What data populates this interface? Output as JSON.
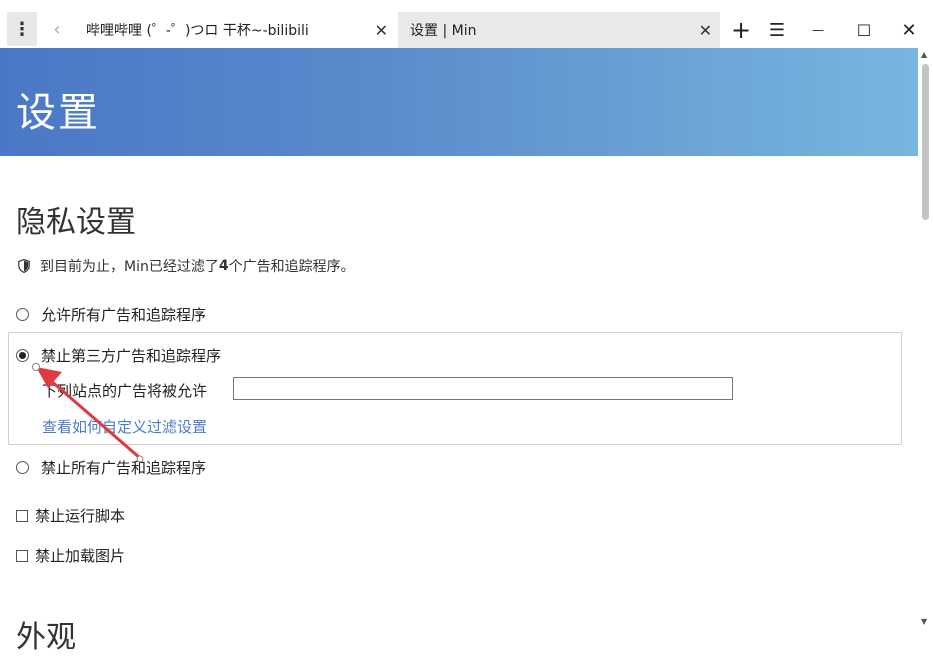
{
  "tabs": {
    "tab1_title": "哔哩哔哩 (゜-゜)つロ 干杯~-bilibili",
    "tab2_title": "设置 | Min"
  },
  "icons": {
    "menu": "⋮",
    "back": "‹",
    "close": "✕",
    "add": "+",
    "list": "☰",
    "minimize": "—",
    "maximize": "☐",
    "window_close": "✕"
  },
  "header": {
    "title": "设置"
  },
  "privacy": {
    "section_title": "隐私设置",
    "info_prefix": "到目前为止，Min已经过滤了",
    "info_count": "4",
    "info_suffix": "个广告和追踪程序。",
    "option_allow_all": "允许所有广告和追踪程序",
    "option_block_third_party": "禁止第三方广告和追踪程序",
    "allowed_sites_label": "下列站点的广告将被允许",
    "allowed_sites_value": "",
    "custom_filter_link": "查看如何自定义过滤设置",
    "option_block_all": "禁止所有广告和追踪程序",
    "block_scripts": "禁止运行脚本",
    "block_images": "禁止加载图片",
    "selected_option": "block_third_party"
  },
  "appearance": {
    "section_title": "外观"
  },
  "colors": {
    "header_start": "#4a78c6",
    "header_end": "#78b6de",
    "link": "#4a7cc9",
    "arrow": "#e0393e"
  }
}
